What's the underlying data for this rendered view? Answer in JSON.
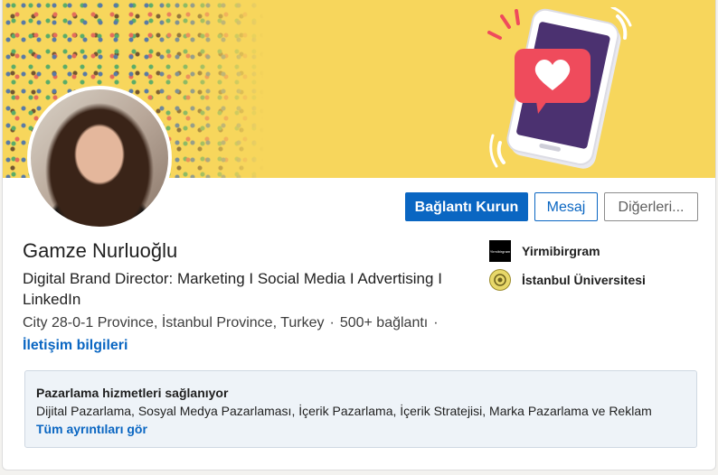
{
  "profile": {
    "name": "Gamze Nurluoğlu",
    "headline": "Digital Brand Director: Marketing I Social Media I Advertising I LinkedIn",
    "location": "City 28-0-1 Province, İstanbul Province, Turkey",
    "separator": "·",
    "connections": "500+ bağlantı",
    "trailing_separator": "·",
    "contact_info": "İletişim bilgileri"
  },
  "actions": {
    "connect": "Bağlantı Kurun",
    "message": "Mesaj",
    "more": "Diğerleri..."
  },
  "organizations": {
    "company": {
      "name": "Yirmibirgram",
      "logo_text": "Yirmibirgram",
      "icon": "company-logo"
    },
    "school": {
      "name": "İstanbul Üniversitesi",
      "icon": "university-seal"
    }
  },
  "services": {
    "title": "Pazarlama hizmetleri sağlanıyor",
    "list": "Dijital Pazarlama, Sosyal Medya Pazarlaması, İçerik Pazarlama, İçerik Stratejisi, Marka Pazarlama ve Reklam",
    "link": "Tüm ayrıntıları gör"
  },
  "colors": {
    "accent": "#0a66c2",
    "banner": "#f7d65c",
    "like_bubble": "#ef4b5c",
    "phone": "#4b3170"
  }
}
